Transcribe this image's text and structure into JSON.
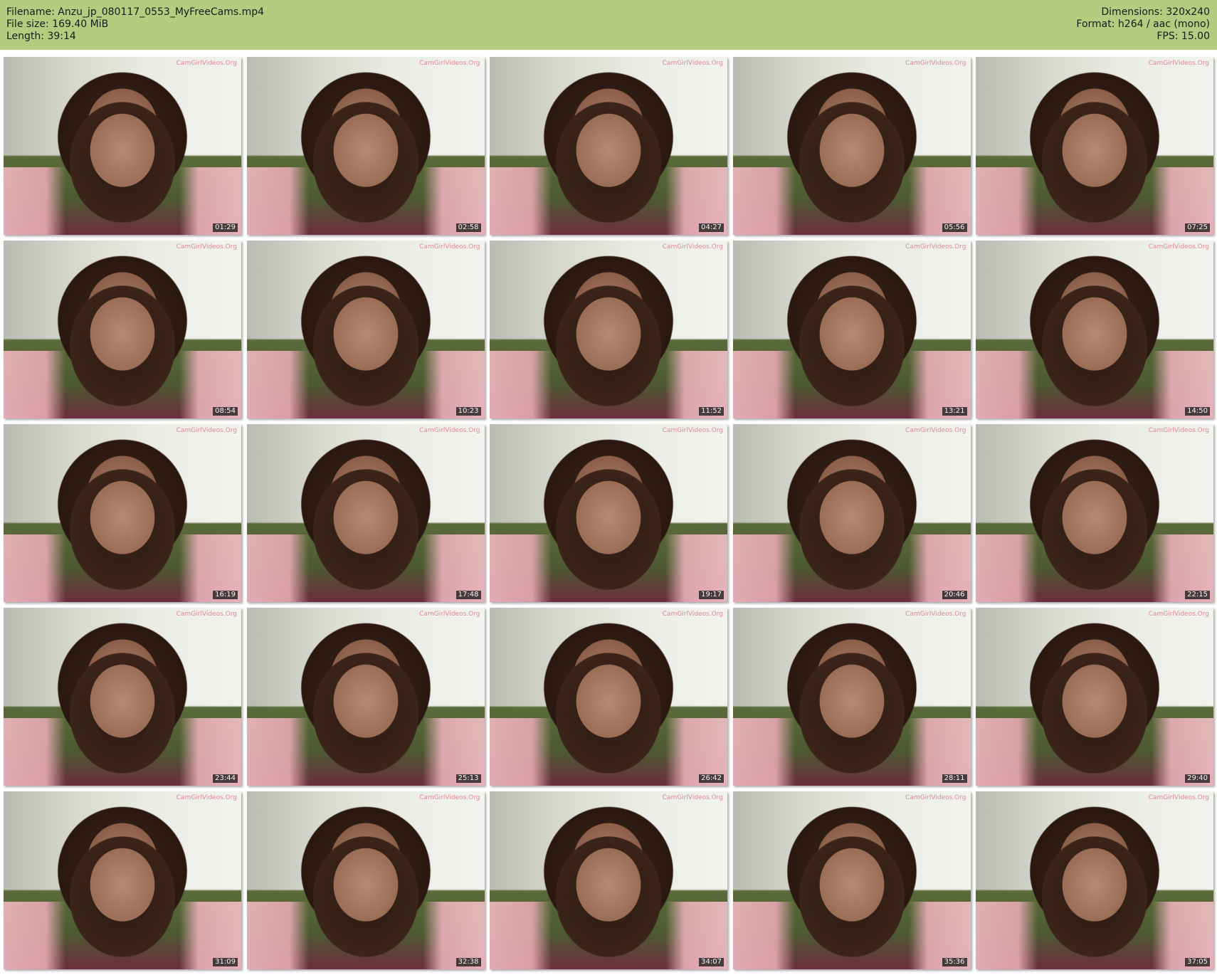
{
  "header": {
    "filename_line": "Filename: Anzu_jp_080117_0553_MyFreeCams.mp4",
    "filesize_line": "File size: 169.40 MiB",
    "length_line": "Length: 39:14",
    "dimensions_line": "Dimensions: 320x240",
    "format_line": "Format: h264 / aac (mono)",
    "fps_line": "FPS: 15.00"
  },
  "thumbnails": [
    {
      "timestamp": "01:29",
      "watermark": "CamGirlVideos.Org"
    },
    {
      "timestamp": "02:58",
      "watermark": "CamGirlVideos.Org"
    },
    {
      "timestamp": "04:27",
      "watermark": "CamGirlVideos.Org"
    },
    {
      "timestamp": "05:56",
      "watermark": "CamGirlVideos.Org"
    },
    {
      "timestamp": "07:25",
      "watermark": "CamGirlVideos.Org"
    },
    {
      "timestamp": "08:54",
      "watermark": "CamGirlVideos.Org"
    },
    {
      "timestamp": "10:23",
      "watermark": "CamGirlVideos.Org"
    },
    {
      "timestamp": "11:52",
      "watermark": "CamGirlVideos.Org"
    },
    {
      "timestamp": "13:21",
      "watermark": "CamGirlVideos.Org"
    },
    {
      "timestamp": "14:50",
      "watermark": "CamGirlVideos.Org"
    },
    {
      "timestamp": "16:19",
      "watermark": "CamGirlVideos.Org"
    },
    {
      "timestamp": "17:48",
      "watermark": "CamGirlVideos.Org"
    },
    {
      "timestamp": "19:17",
      "watermark": "CamGirlVideos.Org"
    },
    {
      "timestamp": "20:46",
      "watermark": "CamGirlVideos.Org"
    },
    {
      "timestamp": "22:15",
      "watermark": "CamGirlVideos.Org"
    },
    {
      "timestamp": "23:44",
      "watermark": "CamGirlVideos.Org"
    },
    {
      "timestamp": "25:13",
      "watermark": "CamGirlVideos.Org"
    },
    {
      "timestamp": "26:42",
      "watermark": "CamGirlVideos.Org"
    },
    {
      "timestamp": "28:11",
      "watermark": "CamGirlVideos.Org"
    },
    {
      "timestamp": "29:40",
      "watermark": "CamGirlVideos.Org"
    },
    {
      "timestamp": "31:09",
      "watermark": "CamGirlVideos.Org"
    },
    {
      "timestamp": "32:38",
      "watermark": "CamGirlVideos.Org"
    },
    {
      "timestamp": "34:07",
      "watermark": "CamGirlVideos.Org"
    },
    {
      "timestamp": "35:36",
      "watermark": "CamGirlVideos.Org"
    },
    {
      "timestamp": "37:05",
      "watermark": "CamGirlVideos.Org"
    }
  ],
  "colors": {
    "header_bg": "#b3cc80",
    "page_bg": "#ffffff",
    "timestamp_bg": "#141414",
    "timestamp_text": "#f2f2f2"
  }
}
